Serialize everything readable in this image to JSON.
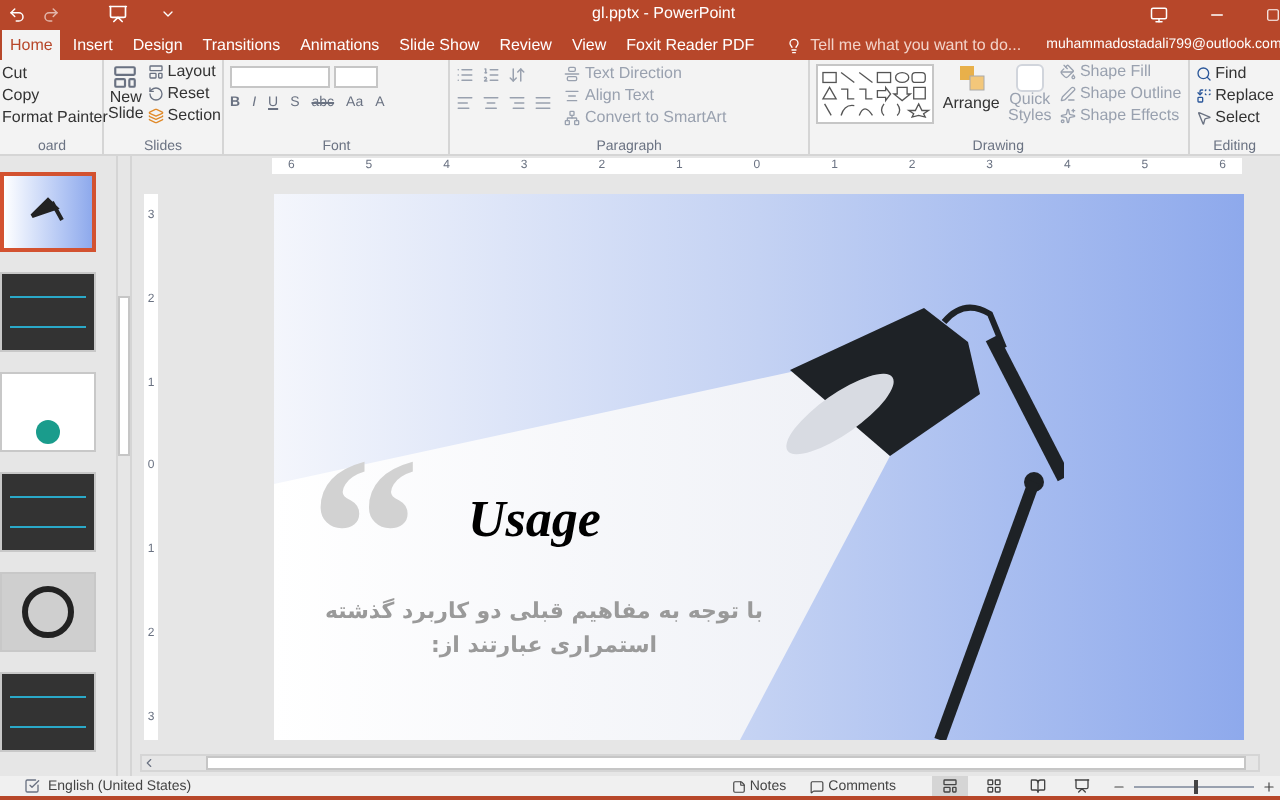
{
  "window": {
    "title": "gl.pptx - PowerPoint"
  },
  "tabs": [
    {
      "label": "Home",
      "selected": true
    },
    {
      "label": "Insert",
      "selected": false
    },
    {
      "label": "Design",
      "selected": false
    },
    {
      "label": "Transitions",
      "selected": false
    },
    {
      "label": "Animations",
      "selected": false
    },
    {
      "label": "Slide Show",
      "selected": false
    },
    {
      "label": "Review",
      "selected": false
    },
    {
      "label": "View",
      "selected": false
    },
    {
      "label": "Foxit Reader PDF",
      "selected": false
    }
  ],
  "tell_me": {
    "placeholder": "Tell me what you want to do..."
  },
  "account": "muhammadostadali799@outlook.com",
  "ribbon": {
    "clipboard": {
      "label": "oard",
      "items": [
        "Cut",
        "Copy",
        "Format Painter"
      ]
    },
    "slides": {
      "label": "Slides",
      "new_slide": "New Slide",
      "items": [
        "Layout",
        "Reset",
        "Section"
      ]
    },
    "font": {
      "label": "Font",
      "buttons": [
        "B",
        "I",
        "U",
        "S",
        "abc",
        "Aa",
        "A"
      ]
    },
    "paragraph": {
      "label": "Paragraph",
      "items": [
        "Text Direction",
        "Align Text",
        "Convert to SmartArt"
      ]
    },
    "drawing": {
      "label": "Drawing",
      "arrange": "Arrange",
      "quick_styles": "Quick Styles",
      "items": [
        "Shape Fill",
        "Shape Outline",
        "Shape Effects"
      ]
    },
    "editing": {
      "label": "Editing",
      "items": [
        "Find",
        "Replace",
        "Select"
      ]
    }
  },
  "rulers": {
    "horizontal": [
      "6",
      "5",
      "4",
      "3",
      "2",
      "1",
      "0",
      "1",
      "2",
      "3",
      "4",
      "5",
      "6"
    ],
    "vertical": [
      "3",
      "2",
      "1",
      "0",
      "1",
      "2",
      "3"
    ]
  },
  "thumbnails": [
    {
      "kind": "lamp",
      "selected": true
    },
    {
      "kind": "dark",
      "selected": false
    },
    {
      "kind": "light",
      "selected": false
    },
    {
      "kind": "dark",
      "selected": false
    },
    {
      "kind": "circle",
      "selected": false
    },
    {
      "kind": "dark",
      "selected": false
    }
  ],
  "slide": {
    "quote": "“",
    "title": "Usage",
    "body": "با توجه به مفاهیم قبلی دو کاربرد گذشته استمراری عبارتند از:"
  },
  "status_bar": {
    "language": "English (United States)",
    "notes": "Notes",
    "comments": "Comments",
    "views": [
      {
        "selected": true
      },
      {
        "selected": false
      },
      {
        "selected": false
      },
      {
        "selected": false
      }
    ],
    "zoom": {
      "level": 0.5
    }
  }
}
